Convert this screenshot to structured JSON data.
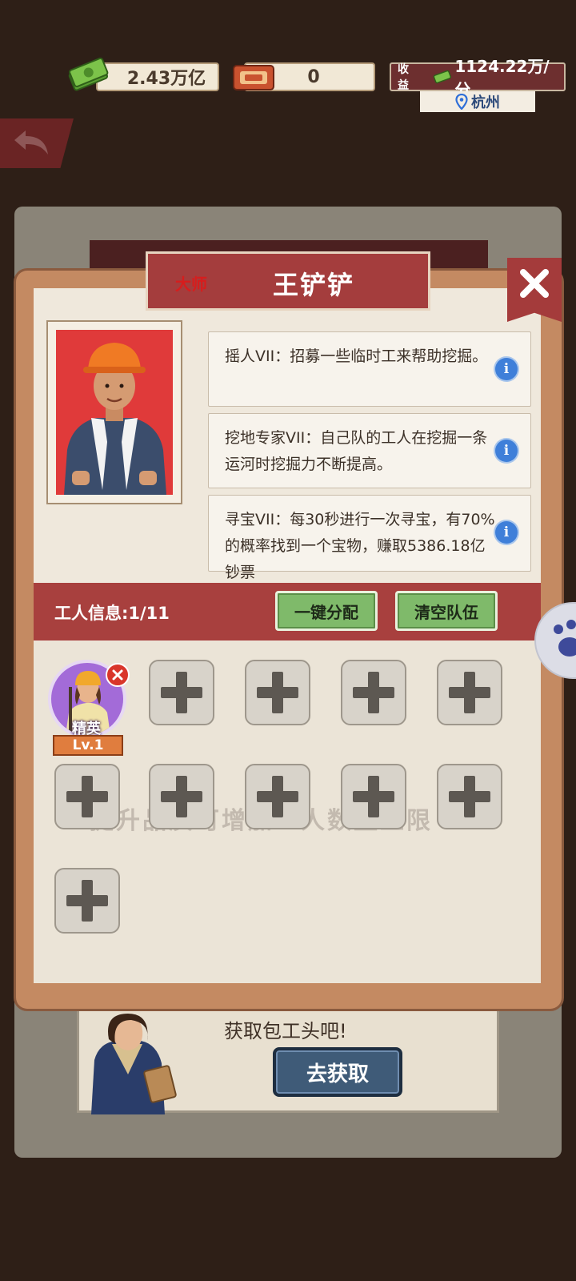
{
  "top_bar": {
    "money": "2.43万亿",
    "tickets": "0",
    "income_label": "收益",
    "income_value": "1124.22万/分",
    "city": "杭州"
  },
  "dialog": {
    "rank": "大师",
    "name": "王铲铲",
    "skills": [
      {
        "text": "摇人VII：招募一些临时工来帮助挖掘。"
      },
      {
        "text": "挖地专家VII：自己队的工人在挖掘一条运河时挖掘力不断提高。"
      },
      {
        "text": "寻宝VII：每30秒进行一次寻宝，有70%的概率找到一个宝物，赚取5386.18亿钞票"
      }
    ],
    "worker_info": "工人信息:1/11",
    "auto_assign_label": "一键分配",
    "clear_team_label": "清空队伍",
    "hint": "提升品质可增加工人数量上限",
    "worker": {
      "grade": "精英",
      "level": "Lv.1"
    }
  },
  "recruit": {
    "text": "获取包工头吧!",
    "button_label": "去获取"
  },
  "colors": {
    "banner_red": "#a43d3d",
    "button_green": "#7fba6a",
    "income_bg": "#6d2f2f",
    "info_blue": "#3f7fd9"
  }
}
